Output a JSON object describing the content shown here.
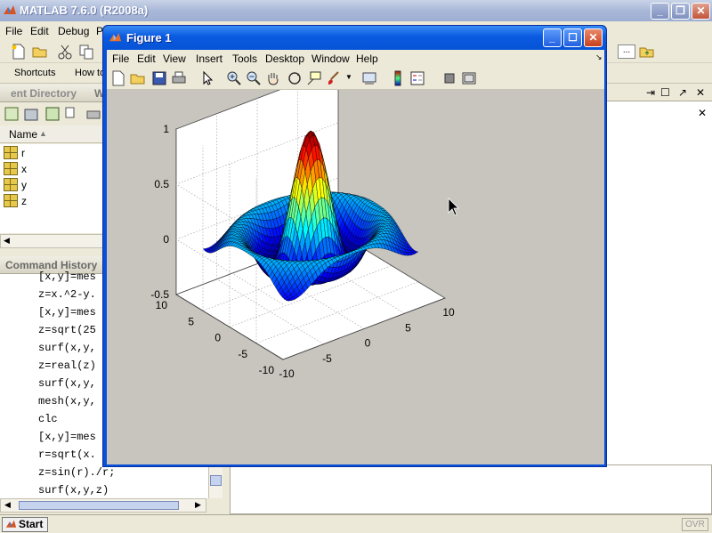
{
  "app": {
    "title": "MATLAB  7.6.0 (R2008a)"
  },
  "main_menu": [
    "File",
    "Edit",
    "Debug",
    "P"
  ],
  "shortcuts": {
    "label": "Shortcuts",
    "howto": "How to"
  },
  "current_directory": {
    "title": "ent Directory",
    "tab2": "W",
    "column": "Name"
  },
  "workspace_vars": [
    "r",
    "x",
    "y",
    "z"
  ],
  "command_history": {
    "title": "Command History",
    "lines": [
      "[x,y]=mes",
      "z=x.^2-y.",
      "[x,y]=mes",
      "z=sqrt(25",
      "surf(x,y,",
      "z=real(z)",
      "surf(x,y,",
      "mesh(x,y,",
      "clc",
      "[x,y]=mes",
      "r=sqrt(x.",
      "z=sin(r)./r;",
      "surf(x,y,z)"
    ]
  },
  "status": {
    "start": "Start",
    "ovr": "OVR"
  },
  "figure": {
    "title": "Figure 1",
    "menu": [
      "File",
      "Edit",
      "View",
      "Insert",
      "Tools",
      "Desktop",
      "Window",
      "Help"
    ]
  },
  "plot": {
    "z_ticks": [
      "1",
      "0.5",
      "0",
      "-0.5"
    ],
    "y_ticks": [
      "10",
      "5",
      "0",
      "-5",
      "-10"
    ],
    "x_ticks": [
      "-10",
      "-5",
      "0",
      "5",
      "10"
    ]
  },
  "colors": {
    "fig_title": "#0a5ae0",
    "canvas": "#c8c4be",
    "axes_bg": "#ffffff"
  }
}
